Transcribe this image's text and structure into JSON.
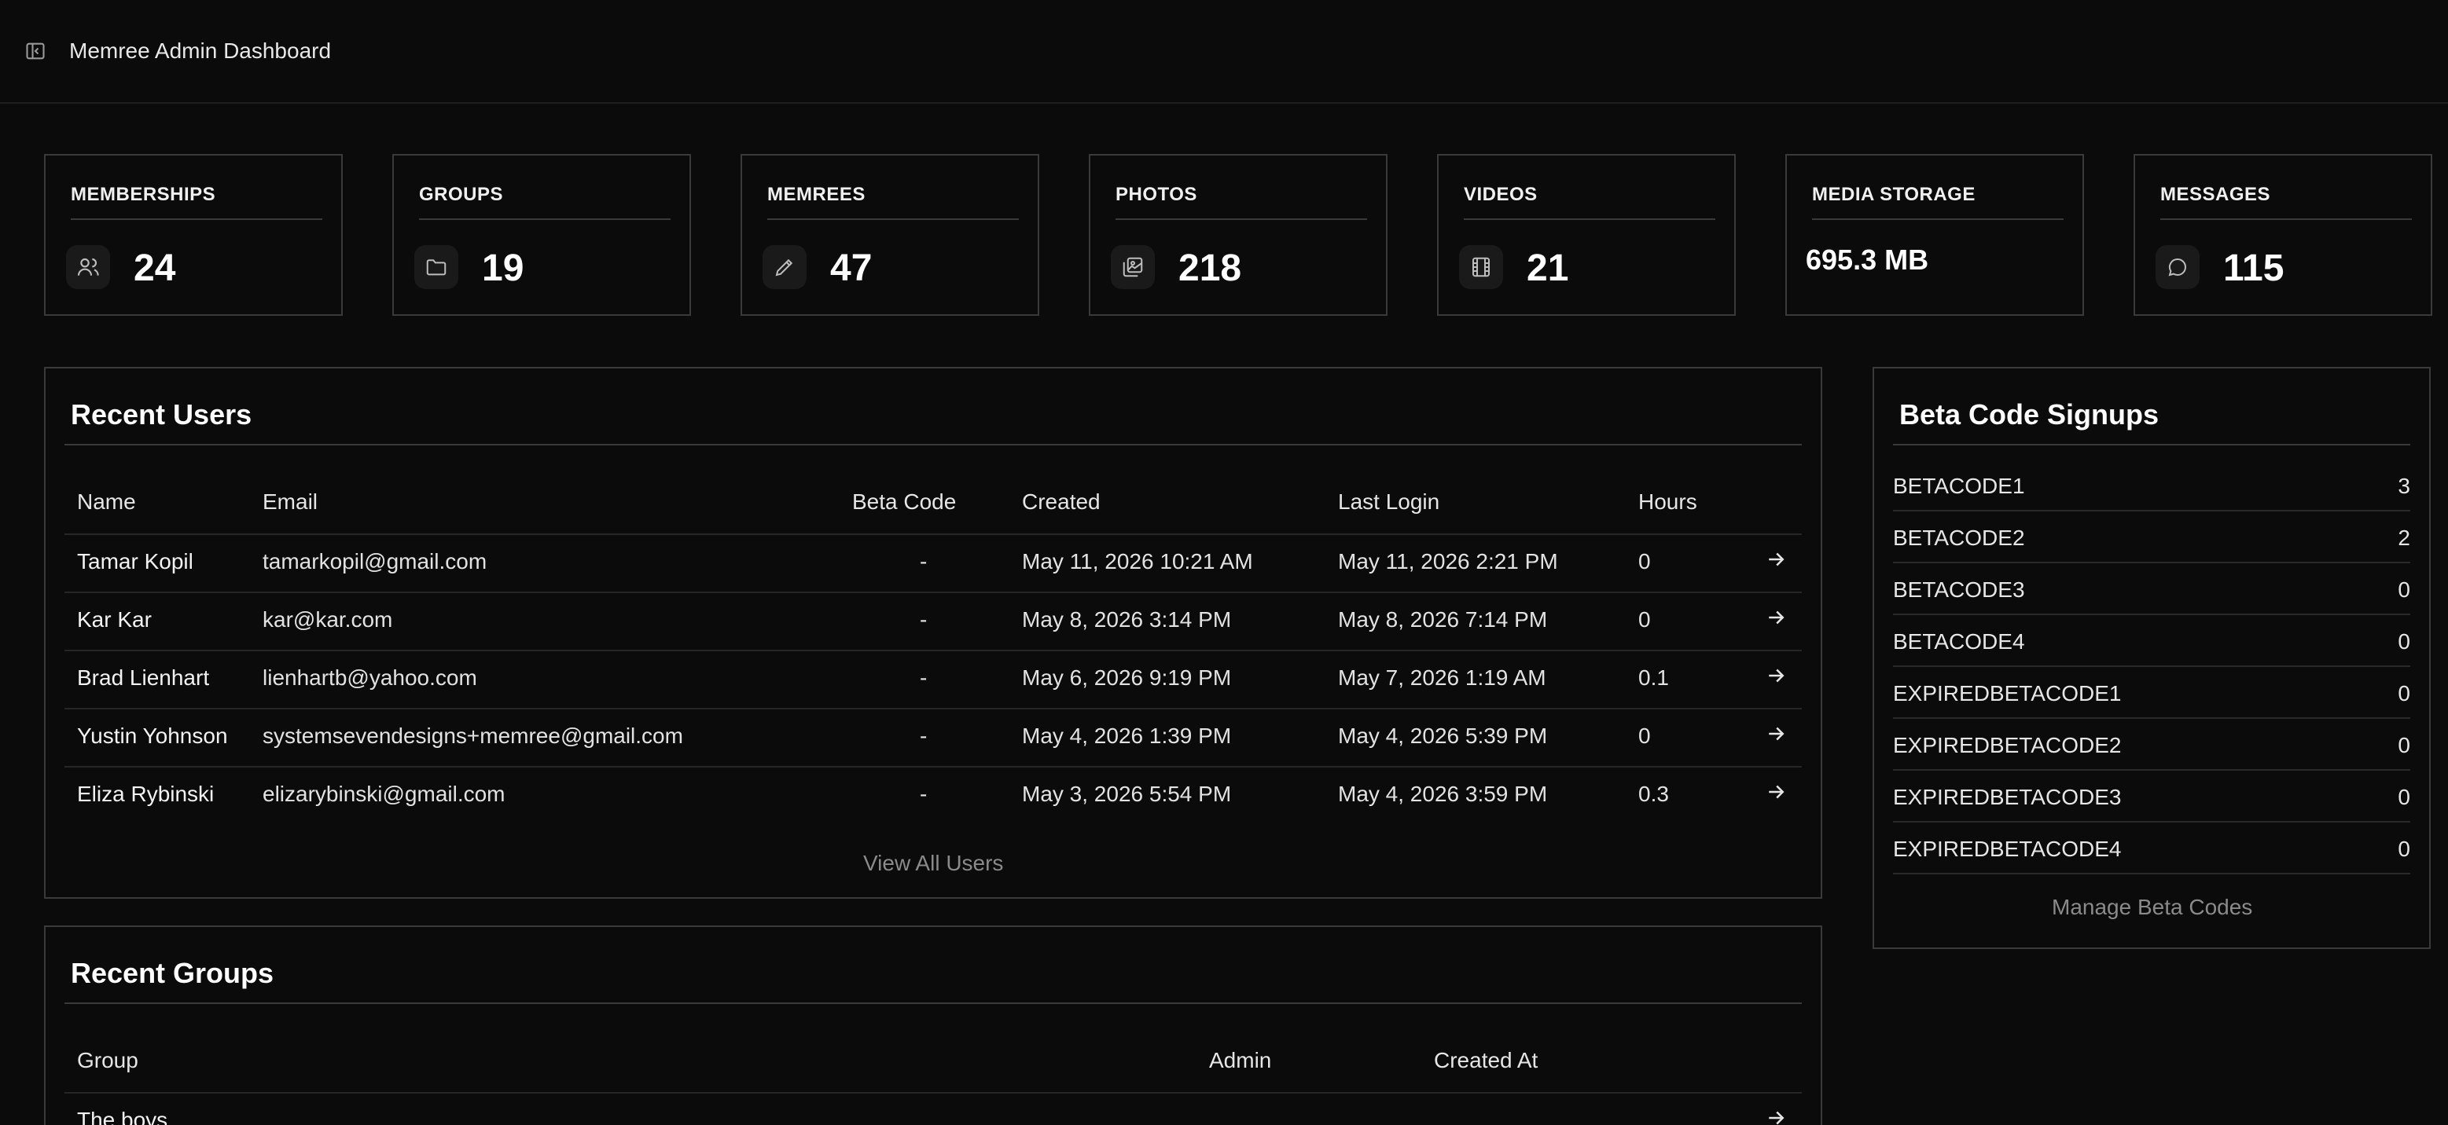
{
  "app": {
    "title": "Memree Admin Dashboard"
  },
  "stats": [
    {
      "label": "MEMBERSHIPS",
      "value": "24",
      "icon": "users-icon"
    },
    {
      "label": "GROUPS",
      "value": "19",
      "icon": "folder-icon"
    },
    {
      "label": "MEMREES",
      "value": "47",
      "icon": "pencil-icon"
    },
    {
      "label": "PHOTOS",
      "value": "218",
      "icon": "photos-icon"
    },
    {
      "label": "VIDEOS",
      "value": "21",
      "icon": "film-icon"
    },
    {
      "label": "MEDIA STORAGE",
      "value": "695.3 MB",
      "icon": ""
    },
    {
      "label": "MESSAGES",
      "value": "115",
      "icon": "chat-icon"
    }
  ],
  "recent_users": {
    "title": "Recent Users",
    "columns": {
      "name": "Name",
      "email": "Email",
      "beta": "Beta Code",
      "created": "Created",
      "last_login": "Last Login",
      "hours": "Hours"
    },
    "rows": [
      {
        "name": "Tamar Kopil",
        "email": "tamarkopil@gmail.com",
        "beta": "-",
        "created": "May 11, 2026 10:21 AM",
        "last_login": "May 11, 2026 2:21 PM",
        "hours": "0"
      },
      {
        "name": "Kar Kar",
        "email": "kar@kar.com",
        "beta": "-",
        "created": "May 8, 2026 3:14 PM",
        "last_login": "May 8, 2026 7:14 PM",
        "hours": "0"
      },
      {
        "name": "Brad Lienhart",
        "email": "lienhartb@yahoo.com",
        "beta": "-",
        "created": "May 6, 2026 9:19 PM",
        "last_login": "May 7, 2026 1:19 AM",
        "hours": "0.1"
      },
      {
        "name": "Yustin Yohnson",
        "email": "systemsevendesigns+memree@gmail.com",
        "beta": "-",
        "created": "May 4, 2026 1:39 PM",
        "last_login": "May 4, 2026 5:39 PM",
        "hours": "0"
      },
      {
        "name": "Eliza Rybinski",
        "email": "elizarybinski@gmail.com",
        "beta": "-",
        "created": "May 3, 2026 5:54 PM",
        "last_login": "May 4, 2026 3:59 PM",
        "hours": "0.3"
      }
    ],
    "view_all": "View All Users"
  },
  "beta_signups": {
    "title": "Beta Code Signups",
    "rows": [
      {
        "code": "BETACODE1",
        "count": "3"
      },
      {
        "code": "BETACODE2",
        "count": "2"
      },
      {
        "code": "BETACODE3",
        "count": "0"
      },
      {
        "code": "BETACODE4",
        "count": "0"
      },
      {
        "code": "EXPIREDBETACODE1",
        "count": "0"
      },
      {
        "code": "EXPIREDBETACODE2",
        "count": "0"
      },
      {
        "code": "EXPIREDBETACODE3",
        "count": "0"
      },
      {
        "code": "EXPIREDBETACODE4",
        "count": "0"
      }
    ],
    "manage": "Manage Beta Codes"
  },
  "recent_groups": {
    "title": "Recent Groups",
    "columns": {
      "group": "Group",
      "admin": "Admin",
      "created_at": "Created At"
    },
    "rows": [
      {
        "group": "The boys"
      }
    ]
  }
}
